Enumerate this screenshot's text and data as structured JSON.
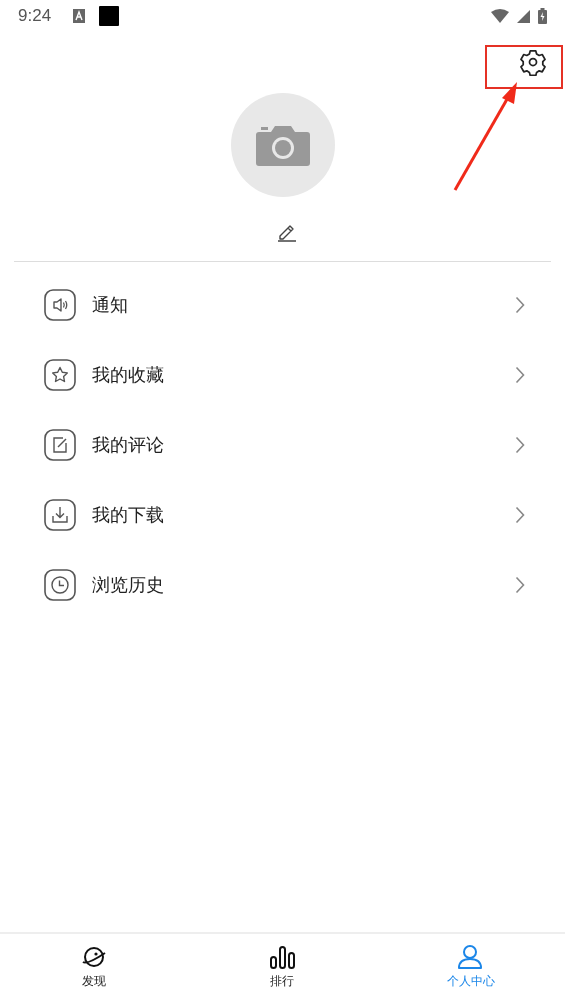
{
  "status_bar": {
    "time": "9:24"
  },
  "menu": [
    {
      "kind": "speaker",
      "label": "通知"
    },
    {
      "kind": "star",
      "label": "我的收藏"
    },
    {
      "kind": "edit",
      "label": "我的评论"
    },
    {
      "kind": "download",
      "label": "我的下载"
    },
    {
      "kind": "clock",
      "label": "浏览历史"
    }
  ],
  "tabs": [
    {
      "kind": "planet",
      "label": "发现",
      "selected": false
    },
    {
      "kind": "chart",
      "label": "排行",
      "selected": false
    },
    {
      "kind": "person",
      "label": "个人中心",
      "selected": true
    }
  ]
}
